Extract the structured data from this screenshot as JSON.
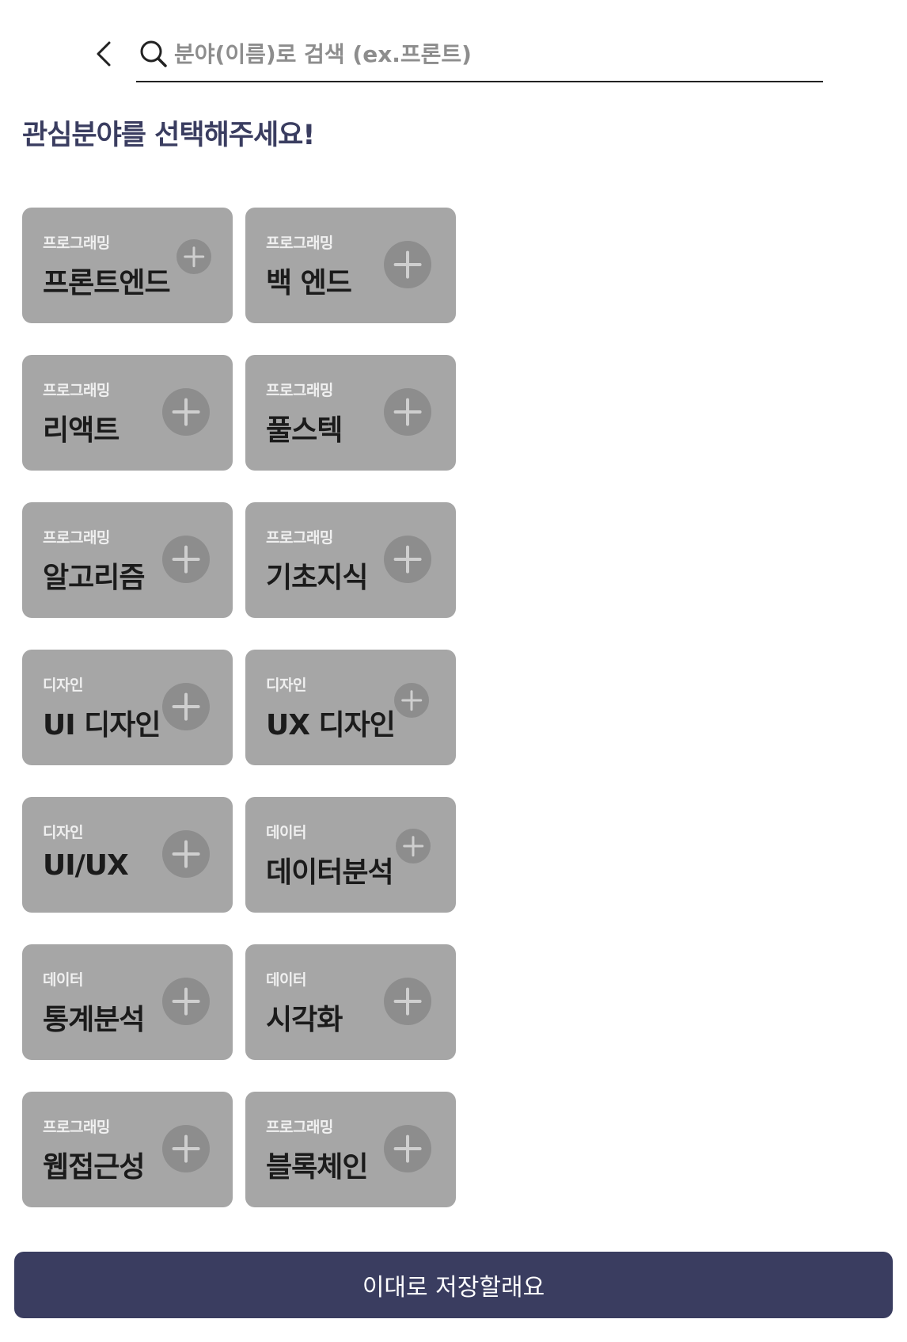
{
  "search": {
    "placeholder": "분야(이름)로 검색 (ex.프론트)",
    "value": ""
  },
  "page_title": "관심분야를 선택해주세요!",
  "fields": [
    {
      "category": "프로그래밍",
      "title": "프론트엔드",
      "icon": "plus-icon"
    },
    {
      "category": "프로그래밍",
      "title": "백 엔드",
      "icon": "plus-icon"
    },
    {
      "category": "프로그래밍",
      "title": "리액트",
      "icon": "plus-icon"
    },
    {
      "category": "프로그래밍",
      "title": "풀스텍",
      "icon": "plus-icon"
    },
    {
      "category": "프로그래밍",
      "title": "알고리즘",
      "icon": "plus-icon"
    },
    {
      "category": "프로그래밍",
      "title": "기초지식",
      "icon": "plus-icon"
    },
    {
      "category": "디자인",
      "title": "UI 디자인",
      "icon": "plus-icon"
    },
    {
      "category": "디자인",
      "title": "UX 디자인",
      "icon": "plus-icon"
    },
    {
      "category": "디자인",
      "title": "UI/UX",
      "icon": "plus-icon"
    },
    {
      "category": "데이터",
      "title": "데이터분석",
      "icon": "plus-icon"
    },
    {
      "category": "데이터",
      "title": "통계분석",
      "icon": "plus-icon"
    },
    {
      "category": "데이터",
      "title": "시각화",
      "icon": "plus-icon"
    },
    {
      "category": "프로그래밍",
      "title": "웹접근성",
      "icon": "plus-icon"
    },
    {
      "category": "프로그래밍",
      "title": "블록체인",
      "icon": "plus-icon"
    }
  ],
  "save_button_label": "이대로 저장할래요",
  "colors": {
    "primary": "#3a3d60",
    "card_background": "#a6a6a6",
    "add_icon_background": "#8d8d8d"
  }
}
